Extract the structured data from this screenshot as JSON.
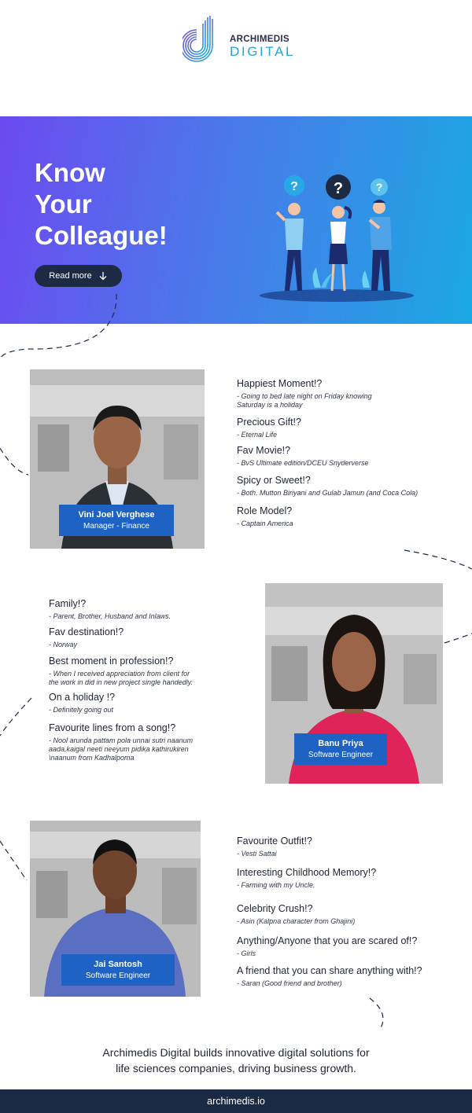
{
  "brand": {
    "name_top": "ARCHIMEDIS",
    "name_bottom": "DIGITAL"
  },
  "hero": {
    "title_lines": [
      "Know",
      "Your",
      "Colleague!"
    ],
    "read_more_label": "Read more"
  },
  "colleagues": [
    {
      "name": "Vini Joel Verghese",
      "role": "Manager - Finance",
      "qa": [
        {
          "q": "Happiest Moment!?",
          "a": "- Going to bed late night on Friday knowing\n   Saturday is a holiday"
        },
        {
          "q": "Precious Gift!?",
          "a": "- Eternal Life"
        },
        {
          "q": "Fav Movie!?",
          "a": "- BvS Ultimate edition/DCEU Snyderverse"
        },
        {
          "q": "Spicy or Sweet!?",
          "a": "- Both. Mutton Biriyani and Gulab Jamun (and Coca Cola)"
        },
        {
          "q": "Role Model?",
          "a": "- Captain America"
        }
      ]
    },
    {
      "name": "Banu Priya",
      "role": "Software Engineer",
      "qa": [
        {
          "q": "Family!?",
          "a": "- Parent, Brother, Husband and Inlaws."
        },
        {
          "q": "Fav destination!?",
          "a": "- Norway"
        },
        {
          "q": "Best moment in profession!?",
          "a": "- When I received appreciation from client for\n   the work in did in new project single handedly."
        },
        {
          "q": "On a holiday !?",
          "a": "- Definitely going out"
        },
        {
          "q": "Favourite lines from a song!?",
          "a": "- Nool arunda pattam pola unnai sutri naanum\n   aada,kaigal neeti neeyum pidika kathirukiren\n   \\naanum from Kadhalpoma"
        }
      ]
    },
    {
      "name": "Jai Santosh",
      "role": "Software Engineer",
      "qa": [
        {
          "q": "Favourite Outfit!?",
          "a": "- Vesti Sattai"
        },
        {
          "q": "Interesting Childhood Memory!?",
          "a": "- Farming with my Uncle."
        },
        {
          "q": "Celebrity Crush!?",
          "a": "- Asin  (Kalpna character  from Ghajini)"
        },
        {
          "q": "Anything/Anyone that you are scared of!?",
          "a": " - Girls"
        },
        {
          "q": "A friend that you can share anything with!?",
          "a": "- Saran (Good friend and brother)"
        }
      ]
    }
  ],
  "footer": {
    "tagline_lines": [
      "Archimedis Digital builds innovative digital solutions for",
      "life sciences companies, driving business growth."
    ],
    "website": "archimedis.io"
  }
}
